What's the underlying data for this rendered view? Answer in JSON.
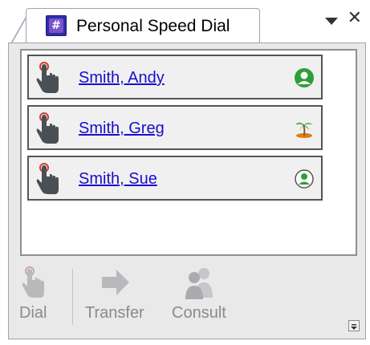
{
  "tab": {
    "title": "Personal Speed Dial",
    "icon": "hash-icon"
  },
  "contacts": [
    {
      "name": "Smith, Andy",
      "status_icon": "available-person-icon",
      "status_color": "#2e9e3a"
    },
    {
      "name": "Smith, Greg",
      "status_icon": "vacation-palm-tree-icon",
      "status_color": "#e07b12"
    },
    {
      "name": "Smith, Sue",
      "status_icon": "away-person-icon",
      "status_color": "#2e9e3a"
    }
  ],
  "toolbar": {
    "dial_label": "Dial",
    "transfer_label": "Transfer",
    "consult_label": "Consult"
  },
  "colors": {
    "link": "#1a0dcc",
    "disabled": "#8a8a8a",
    "accent": "#2b2fa8"
  }
}
